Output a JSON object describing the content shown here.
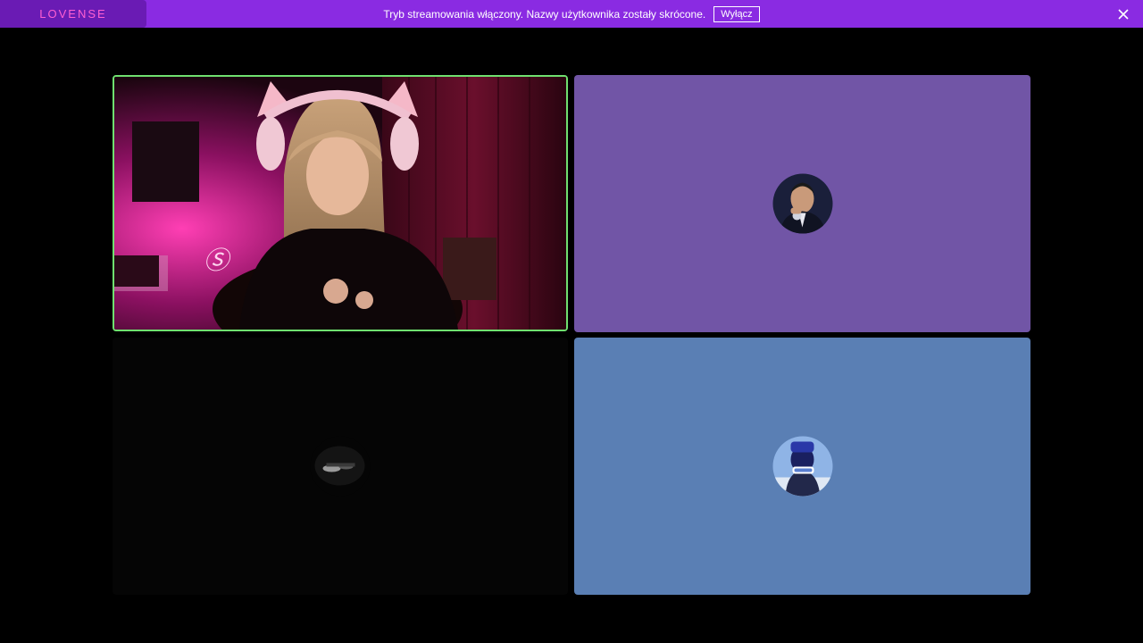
{
  "banner": {
    "brand": "LOVENSE",
    "message": "Tryb streamowania włączony. Nazwy użytkownika zostały skrócone.",
    "disable_label": "Wyłącz"
  },
  "colors": {
    "banner_bg": "#8a2be2",
    "brand_text": "#ff5fd2",
    "active_speaker_border": "#6fe06f",
    "tile_purple": "#7155a6",
    "tile_dark": "#050505",
    "tile_blue": "#5a7fb4"
  },
  "tiles": [
    {
      "kind": "video"
    },
    {
      "kind": "avatar"
    },
    {
      "kind": "avatar"
    },
    {
      "kind": "avatar"
    }
  ]
}
